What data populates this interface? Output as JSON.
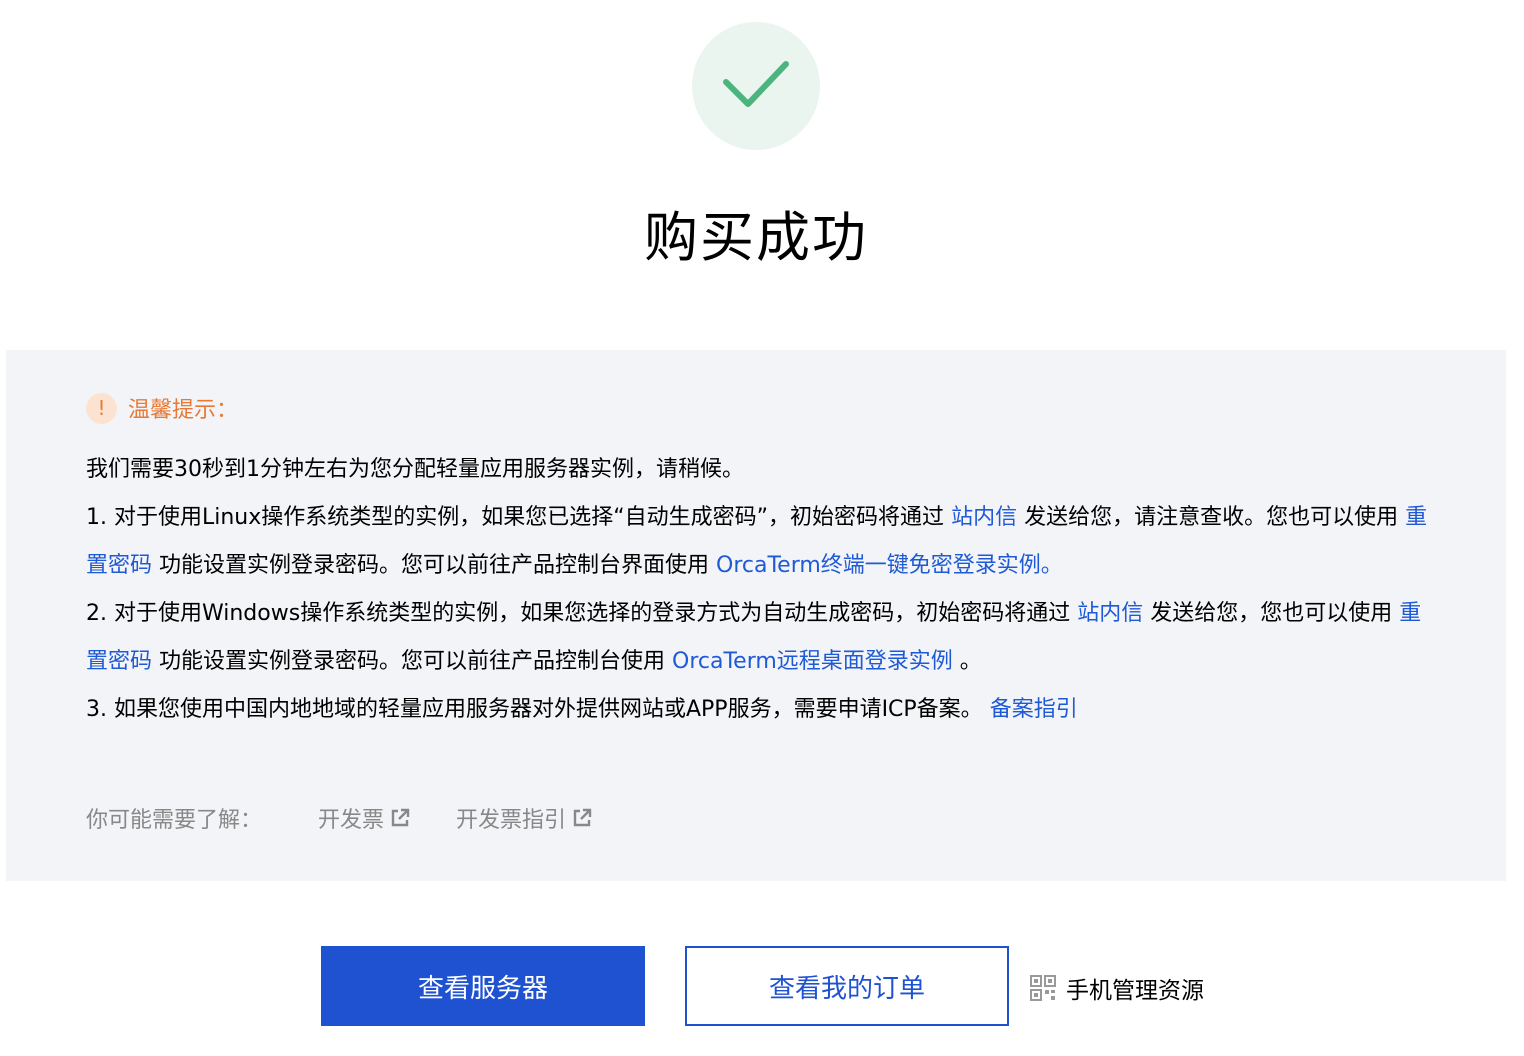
{
  "success": {
    "icon": "check-icon",
    "title": "购买成功"
  },
  "tips": {
    "icon": "warning-icon",
    "title": "温馨提示：",
    "intro": "我们需要30秒到1分钟左右为您分配轻量应用服务器实例，请稍候。",
    "item1": {
      "t1": "1. 对于使用Linux操作系统类型的实例，如果您已选择“自动生成密码”，初始密码将通过 ",
      "link1": "站内信",
      "t2": " 发送给您，请注意查收。您也可以使用 ",
      "link2": "重置密码",
      "t3": " 功能设置实例登录密码。您可以前往产品控制台界面使用 ",
      "link3": "OrcaTerm终端一键免密登录实例。"
    },
    "item2": {
      "t1": "2. 对于使用Windows操作系统类型的实例，如果您选择的登录方式为自动生成密码，初始密码将通过 ",
      "link1": "站内信",
      "t2": " 发送给您，您也可以使用 ",
      "link2": "重置密码",
      "t3": " 功能设置实例登录密码。您可以前往产品控制台使用 ",
      "link3": "OrcaTerm远程桌面登录实例",
      "t4": " 。"
    },
    "item3": {
      "t1": "3. 如果您使用中国内地地域的轻量应用服务器对外提供网站或APP服务，需要申请ICP备案。 ",
      "link1": "备案指引"
    }
  },
  "more": {
    "label": "你可能需要了解：",
    "links": [
      {
        "label": "开发票",
        "icon": "external-link-icon"
      },
      {
        "label": "开发票指引",
        "icon": "external-link-icon"
      }
    ]
  },
  "actions": {
    "view_servers": "查看服务器",
    "view_orders": "查看我的订单",
    "mobile_manage": "手机管理资源",
    "mobile_icon": "qr-code-icon"
  },
  "colors": {
    "primary": "#1f52d1",
    "link": "#1f5ad6",
    "warning": "#e87a37",
    "success": "#4cb47d",
    "panel_bg": "#f3f4f7"
  }
}
